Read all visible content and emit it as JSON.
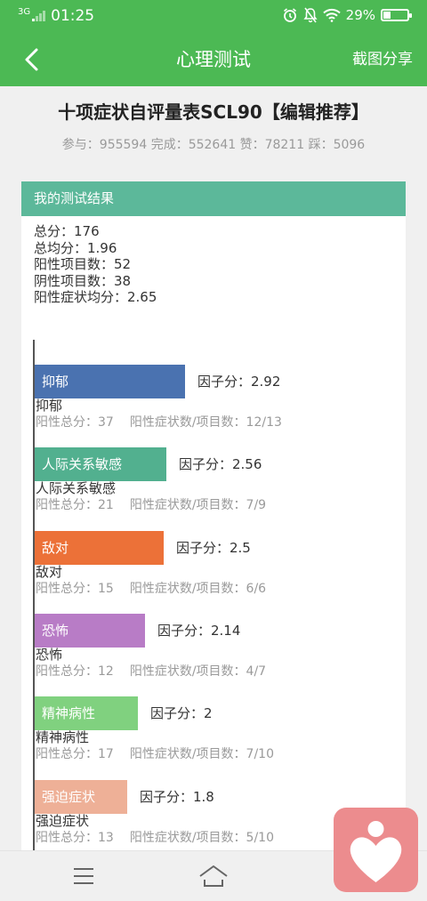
{
  "status_bar": {
    "network": "3G",
    "time": "01:25",
    "battery_pct": "29%",
    "battery_level": 0.29
  },
  "app_bar": {
    "title": "心理测试",
    "share_label": "截图分享"
  },
  "page": {
    "title": "十项症状自评量表SCL90【编辑推荐】",
    "stats": "参与：955594 完成：552641 赞：78211 踩：5096"
  },
  "result": {
    "header": "我的测试结果",
    "summary": [
      "总分：176",
      "总均分：1.96",
      "阳性项目数：52",
      "阴性项目数：38",
      "阳性症状均分：2.65"
    ],
    "factors": [
      {
        "name": "抑郁",
        "score": 2.92,
        "score_text": "因子分：2.92",
        "total_text": "阳性总分：37",
        "ratio_text": "阳性症状数/项目数：12/13",
        "color": "#4a72b0"
      },
      {
        "name": "人际关系敏感",
        "score": 2.56,
        "score_text": "因子分：2.56",
        "total_text": "阳性总分：21",
        "ratio_text": "阳性症状数/项目数：7/9",
        "color": "#52b08f"
      },
      {
        "name": "敌对",
        "score": 2.5,
        "score_text": "因子分：2.5",
        "total_text": "阳性总分：15",
        "ratio_text": "阳性症状数/项目数：6/6",
        "color": "#ec7138"
      },
      {
        "name": "恐怖",
        "score": 2.14,
        "score_text": "因子分：2.14",
        "total_text": "阳性总分：12",
        "ratio_text": "阳性症状数/项目数：4/7",
        "color": "#b87cc6"
      },
      {
        "name": "精神病性",
        "score": 2,
        "score_text": "因子分：2",
        "total_text": "阳性总分：17",
        "ratio_text": "阳性症状数/项目数：7/10",
        "color": "#80d17f"
      },
      {
        "name": "强迫症状",
        "score": 1.8,
        "score_text": "因子分：1.8",
        "total_text": "阳性总分：13",
        "ratio_text": "阳性症状数/项目数：5/10",
        "color": "#eeb097"
      }
    ]
  },
  "colors": {
    "brand": "#4cb954",
    "card_header": "#5cb89a",
    "float_button": "#ec8c8e"
  },
  "icons": {
    "back": "chevron-left-icon",
    "menu": "menu-icon",
    "home": "home-icon",
    "float": "heart-person-icon"
  }
}
